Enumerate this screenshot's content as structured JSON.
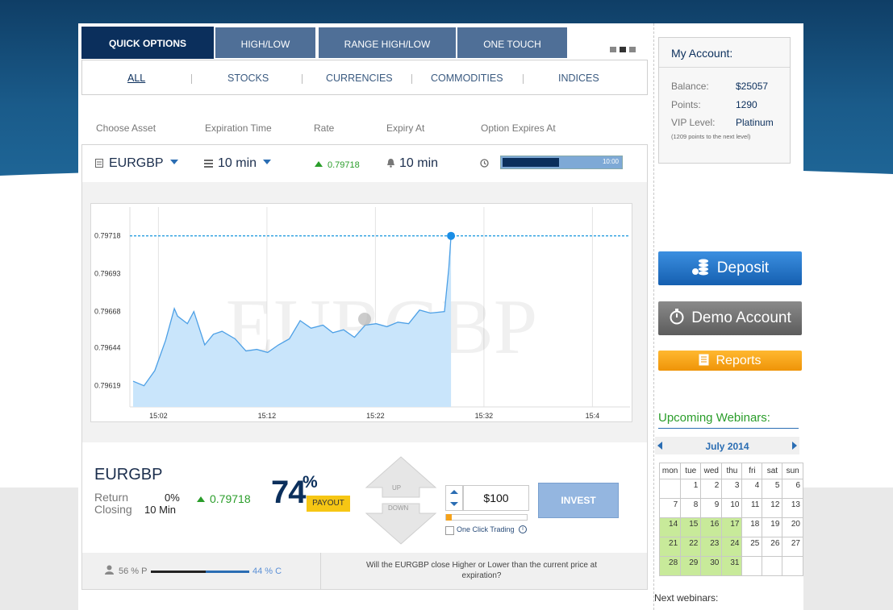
{
  "tabs": [
    {
      "label": "QUICK OPTIONS",
      "active": true
    },
    {
      "label": "HIGH/LOW",
      "active": false
    },
    {
      "label": "RANGE HIGH/LOW",
      "active": false
    },
    {
      "label": "ONE TOUCH",
      "active": false
    }
  ],
  "categories": [
    {
      "label": "ALL",
      "selected": true
    },
    {
      "label": "STOCKS",
      "selected": false
    },
    {
      "label": "CURRENCIES",
      "selected": false
    },
    {
      "label": "COMMODITIES",
      "selected": false
    },
    {
      "label": "INDICES",
      "selected": false
    }
  ],
  "columns": {
    "asset": "Choose Asset",
    "expiration_time": "Expiration Time",
    "rate": "Rate",
    "expiry_at": "Expiry At",
    "option_expires_at": "Option Expires At"
  },
  "asset_row": {
    "asset": "EURGBP",
    "expiration": "10 min",
    "rate": "0.79718",
    "expiry_at": "10 min",
    "progress_label": "10:00",
    "progress_fraction": 0.47
  },
  "chart_data": {
    "type": "area",
    "watermark": "EURGBP",
    "y_ticks": [
      "0.79718",
      "0.79693",
      "0.79668",
      "0.79644",
      "0.79619"
    ],
    "x_ticks": [
      "15:02",
      "15:12",
      "15:22",
      "15:32",
      "15:4"
    ],
    "ylim": [
      0.79605,
      0.79737
    ],
    "current_value": 0.79718,
    "x_minutes": [
      0,
      1,
      2,
      3,
      3.8,
      4.1,
      5,
      5.6,
      6.6,
      7.4,
      8.2,
      9.4,
      10.4,
      11.4,
      12.4,
      13.4,
      14.4,
      15.4,
      16.4,
      17.5,
      18.4,
      19.4,
      20.4,
      21.4,
      22.4,
      23.4,
      24.4,
      25.4,
      26.4,
      27.4,
      28.7,
      29.1,
      29.3
    ],
    "values": [
      0.79622,
      0.79619,
      0.79629,
      0.79649,
      0.7967,
      0.79665,
      0.7966,
      0.79668,
      0.79646,
      0.79653,
      0.79655,
      0.7965,
      0.79642,
      0.79643,
      0.79641,
      0.79646,
      0.7965,
      0.79662,
      0.79657,
      0.79659,
      0.79654,
      0.79656,
      0.79651,
      0.79659,
      0.7966,
      0.79658,
      0.79661,
      0.7966,
      0.79669,
      0.79667,
      0.79668,
      0.79697,
      0.79718
    ]
  },
  "trade": {
    "asset": "EURGBP",
    "return_label": "Return",
    "return_value": "0%",
    "closing_label": "Closing",
    "closing_value": "10 Min",
    "rate": "0.79718",
    "payout_pct": "74",
    "payout_sign": "%",
    "payout_label": "PAYOUT",
    "up_label": "UP",
    "down_label": "DOWN",
    "amount": "$100",
    "one_click": "One Click Trading",
    "invest": "INVEST"
  },
  "sentiment": {
    "put": "56 % P",
    "call": "44 % C",
    "put_fraction": 0.56,
    "question": "Will the EURGBP close Higher or Lower than the current price at expiration?"
  },
  "account": {
    "title": "My Account:",
    "balance_label": "Balance:",
    "balance": "$25057",
    "points_label": "Points:",
    "points": "1290",
    "vip_label": "VIP Level:",
    "vip": "Platinum",
    "next_level": "(1209 points to the next level)"
  },
  "buttons": {
    "deposit": "Deposit",
    "demo": "Demo Account",
    "reports": "Reports"
  },
  "colors": {
    "navy": "#0b2f5c",
    "tab": "#4f6f97",
    "deposit": "#1a6fc2",
    "demo": "#6e6e6e",
    "reports": "#f5a21b",
    "green_rate": "#2a9d2a",
    "highlight": "#c8ea9a"
  },
  "webinars": {
    "title": "Upcoming Webinars:",
    "month": "July 2014",
    "days": [
      "mon",
      "tue",
      "wed",
      "thu",
      "fri",
      "sat",
      "sun"
    ],
    "weeks": [
      [
        "",
        "1",
        "2",
        "3",
        "4",
        "5",
        "6"
      ],
      [
        "7",
        "8",
        "9",
        "10",
        "11",
        "12",
        "13"
      ],
      [
        "14",
        "15",
        "16",
        "17",
        "18",
        "19",
        "20"
      ],
      [
        "21",
        "22",
        "23",
        "24",
        "25",
        "26",
        "27"
      ],
      [
        "28",
        "29",
        "30",
        "31",
        "",
        "",
        ""
      ]
    ],
    "highlighted": [
      "14",
      "15",
      "16",
      "17",
      "21",
      "22",
      "23",
      "24",
      "28",
      "29",
      "30",
      "31"
    ],
    "next_label": "Next webinars:"
  }
}
